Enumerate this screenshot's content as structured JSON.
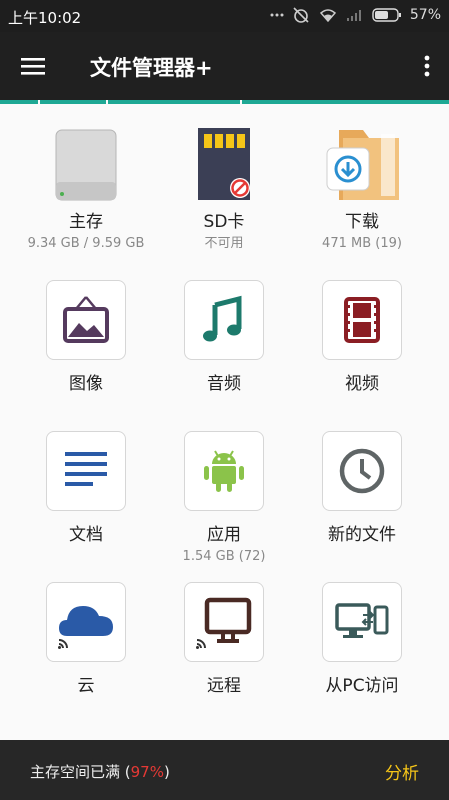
{
  "status_bar": {
    "time": "上午10:02",
    "battery": "57%"
  },
  "app_bar": {
    "title": "文件管理器+"
  },
  "storage": [
    {
      "label": "主存",
      "sub": "9.34 GB / 9.59 GB"
    },
    {
      "label": "SD卡",
      "sub": "不可用"
    },
    {
      "label": "下载",
      "sub": "471 MB (19)"
    }
  ],
  "categories": [
    {
      "label": "图像",
      "sub": ""
    },
    {
      "label": "音频",
      "sub": ""
    },
    {
      "label": "视频",
      "sub": ""
    },
    {
      "label": "文档",
      "sub": ""
    },
    {
      "label": "应用",
      "sub": "1.54 GB (72)"
    },
    {
      "label": "新的文件",
      "sub": ""
    },
    {
      "label": "云",
      "sub": ""
    },
    {
      "label": "远程",
      "sub": ""
    },
    {
      "label": "从PC访问",
      "sub": ""
    }
  ],
  "bottom_bar": {
    "message_prefix": "主存空间已满 (",
    "percent": "97%",
    "message_suffix": ")",
    "action_label": "分析"
  },
  "colors": {
    "accent": "#1ea894",
    "warning": "#e53935",
    "action": "#f5c518"
  }
}
